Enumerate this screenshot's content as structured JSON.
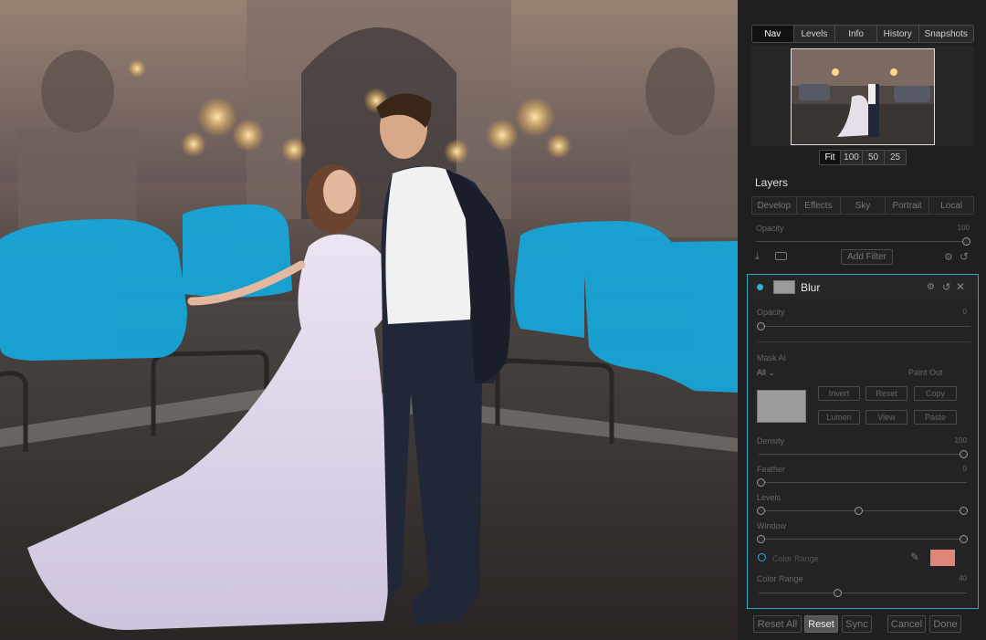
{
  "tabs": [
    "Nav",
    "Levels",
    "Info",
    "History",
    "Snapshots"
  ],
  "active_tab": "Nav",
  "zoom_options": [
    "Fit",
    "100",
    "50",
    "25"
  ],
  "layers": {
    "title": "Layers",
    "filter_tabs": [
      "Develop",
      "Effects",
      "Sky",
      "Portrait",
      "Local"
    ],
    "opacity_label": "Opacity",
    "opacity_value": "100",
    "opacity_fraction": 1.0,
    "add_filter": "Add Filter"
  },
  "blur": {
    "title": "Blur",
    "opacity_label": "Opacity",
    "opacity_value": "0",
    "mask_label": "Mask AI",
    "mask_select": "All",
    "paint_out": "Paint Out",
    "mask_buttons": [
      "Invert",
      "Reset",
      "Copy",
      "Lumen",
      "View",
      "Paste"
    ],
    "density_label": "Density",
    "density_value": "100",
    "feather_label": "Feather",
    "feather_value": "0",
    "levels_label": "Levels",
    "window_label": "Window",
    "color_range_toggle": "Color Range",
    "color_range_label": "Color Range",
    "color_range_value": "40",
    "swatch_color": "#e0857a",
    "accent_color": "#2aa8c8"
  },
  "footer": [
    "Reset All",
    "Reset",
    "Sync",
    "Cancel",
    "Done"
  ],
  "icons": [
    "download-icon",
    "camera-icon",
    "gear-icon",
    "undo-icon",
    "close-icon",
    "eyedropper-icon"
  ]
}
